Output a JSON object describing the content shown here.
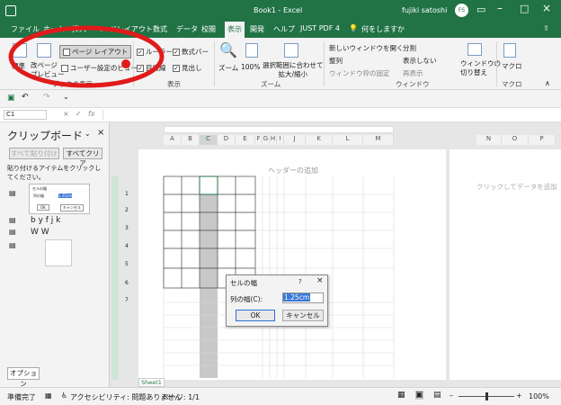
{
  "title": {
    "book": "Book1 - Excel",
    "user": "fujiki satoshi",
    "initials": "FS"
  },
  "tabs": [
    "ファイル",
    "ホーム",
    "挿入",
    "ページレイアウト",
    "数式",
    "データ",
    "校閲",
    "表示",
    "開発",
    "ヘルプ",
    "JUST PDF 4"
  ],
  "search": "何をしますか",
  "ribbon": {
    "normal": "標準",
    "pagebreak": "改ページ\nプレビュー",
    "pagelayout": "ページ レイアウト",
    "userview": "ユーザー設定のビュー",
    "ruler": "ルーラー",
    "formulabar": "数式バー",
    "gridlines": "目盛線",
    "headings": "見出し",
    "zoom": "ズーム",
    "zoom100": "100%",
    "zoomsel": "選択範囲に合わせて\n拡大/縮小",
    "newwin": "新しいウィンドウを開く",
    "arrange": "整列",
    "freeze": "ウィンドウ枠の固定",
    "split": "分割",
    "hide": "表示しない",
    "unhide": "再表示",
    "switch": "ウィンドウの\n切り替え",
    "macro": "マクロ",
    "groups": {
      "views": "ブックの表示",
      "show": "表示",
      "zoom": "ズーム",
      "window": "ウィンドウ",
      "macro": "マクロ"
    }
  },
  "namebox": "C1",
  "clipboard": {
    "title": "クリップボード",
    "pasteall": "すべて貼り付け",
    "clearall": "すべてクリア",
    "hint": "貼り付けるアイテムをクリックしてください。",
    "item2": "b y f j k",
    "item3": "W W",
    "options": "オプション",
    "thumb_label": "列の幅",
    "thumb_value": "1.25cm",
    "thumb_ok": "OK",
    "thumb_cancel": "キャンセル",
    "thumb_title": "セルの幅"
  },
  "columns": [
    "A",
    "B",
    "C",
    "D",
    "E",
    "F",
    "G",
    "H",
    "I",
    "J",
    "K",
    "L",
    "M",
    "N",
    "O",
    "P"
  ],
  "rows": [
    "1",
    "2",
    "3",
    "4",
    "5",
    "6",
    "7"
  ],
  "sheet": {
    "header_add": "ヘッダーの追加",
    "click_data": "クリックしてデータを追加",
    "tab": "Sheet1"
  },
  "dialog": {
    "title": "セルの幅",
    "help": "?",
    "close": "×",
    "label": "列の幅(C):",
    "value": "1.25cm",
    "ok": "OK",
    "cancel": "キャンセル"
  },
  "status": {
    "ready": "準備完了",
    "access": "アクセシビリティ: 問題ありません",
    "page": "ページ: 1/1",
    "zoom": "100%"
  },
  "colors": {
    "excel_green": "#217346",
    "annotation_red": "#e11a1a"
  }
}
